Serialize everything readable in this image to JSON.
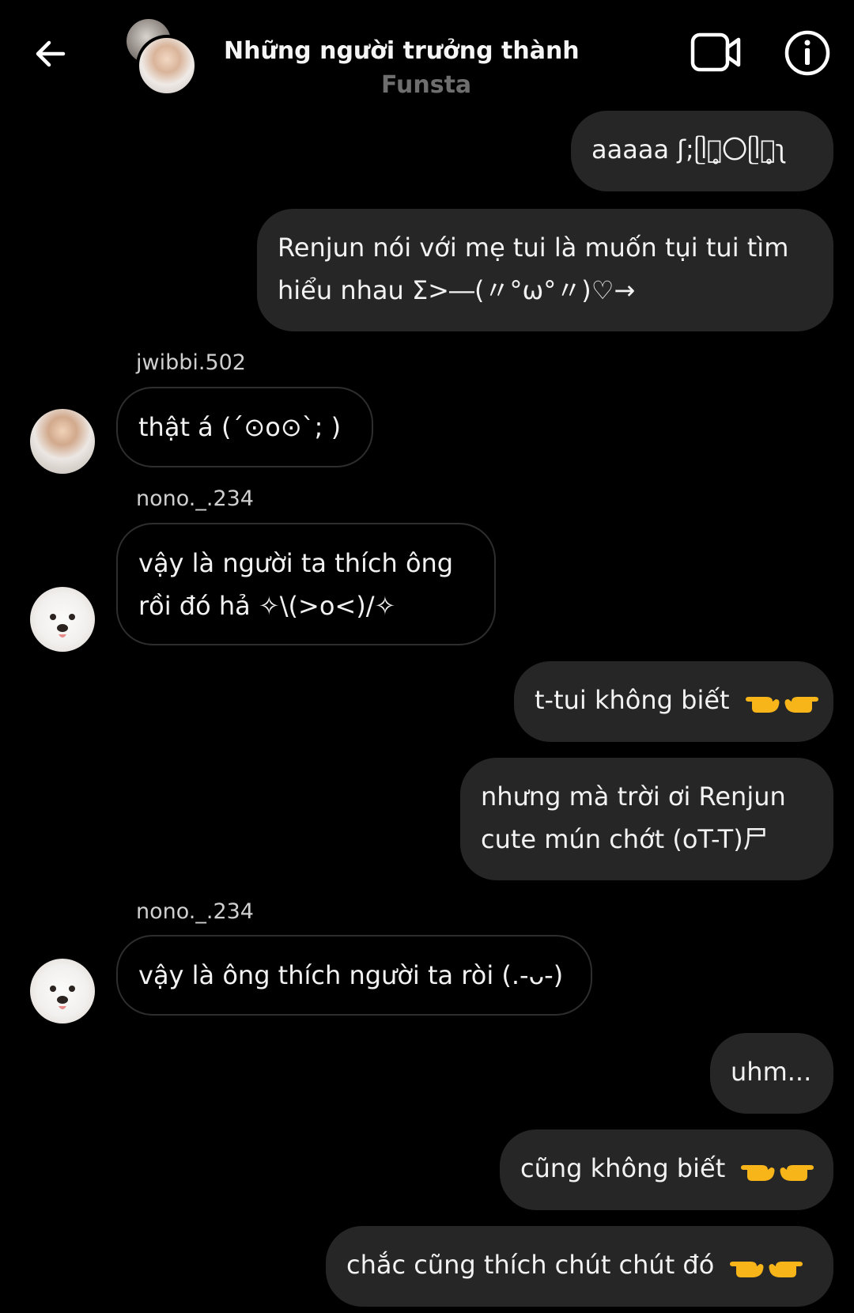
{
  "header": {
    "title": "Những người trưởng thành",
    "subtitle": "Funsta"
  },
  "messages": [
    {
      "side": "out",
      "text": "aaaaa ʃ;ᥫᩣ̥〇ᥫᩣ̥ʅ"
    },
    {
      "side": "out",
      "line1": "Renjun nói với mẹ tui là muốn tụi tui tìm",
      "line2": "hiểu nhau Σ>―(〃°ω°〃)♡→"
    },
    {
      "side": "in",
      "sender": "jwibbi.502",
      "text": "thật á (´⊙o⊙`; )"
    },
    {
      "side": "in",
      "sender": "nono._.234",
      "line1": "vậy là người ta thích ông",
      "line2": "rồi đó hả ✧\\(>o<)/✧"
    },
    {
      "side": "out",
      "text": "t-tui không biết"
    },
    {
      "side": "out",
      "line1": "nhưng mà trời ơi Renjun",
      "line2": "cute mún chớt (oT-T)尸"
    },
    {
      "side": "in",
      "sender": "nono._.234",
      "text": "vậy là ông thích người ta ròi (.-ᴗ-)"
    },
    {
      "side": "out",
      "text": "uhm..."
    },
    {
      "side": "out",
      "text": "cũng không biết"
    },
    {
      "side": "out",
      "text": "chắc cũng thích chút chút đó"
    }
  ],
  "colors": {
    "background": "#000000",
    "bubble_out": "#262626",
    "bubble_in_border": "#2e2e2e",
    "emoji_yellow": "#f7b51a"
  },
  "icons": {
    "back": "arrow-left-icon",
    "video": "video-camera-icon",
    "info": "info-icon",
    "hands": "pointing-hands-emoji"
  }
}
